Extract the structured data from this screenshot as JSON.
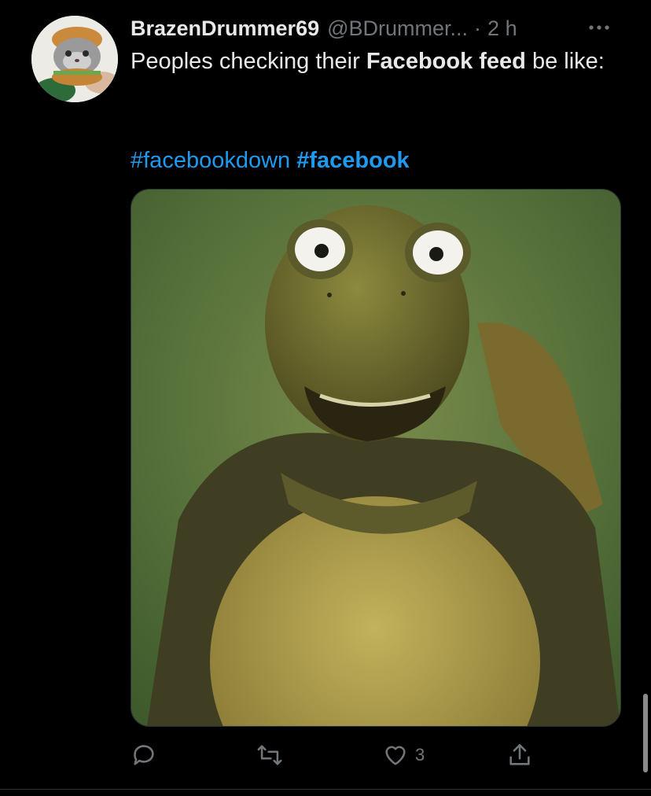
{
  "tweet": {
    "author": {
      "display_name": "BrazenDrummer69",
      "handle": "@BDrummer...",
      "avatar_icon": "cat-in-burger-avatar"
    },
    "separator": "·",
    "time": "2 h",
    "more_icon": "more-horizontal-icon",
    "text": {
      "part1": "Peoples checking their ",
      "bold": "Facebook feed",
      "part2": " be like:"
    },
    "hashtags": [
      "#facebookdown",
      "#facebook"
    ],
    "media": {
      "description_icon": "surprised-turtle-image"
    },
    "actions": {
      "reply_icon": "reply-icon",
      "retweet_icon": "retweet-icon",
      "like_icon": "heart-icon",
      "like_count": "3",
      "share_icon": "share-icon"
    }
  },
  "colors": {
    "background": "#000000",
    "text": "#e7e9ea",
    "muted": "#71767b",
    "accent": "#1d9bf0"
  }
}
